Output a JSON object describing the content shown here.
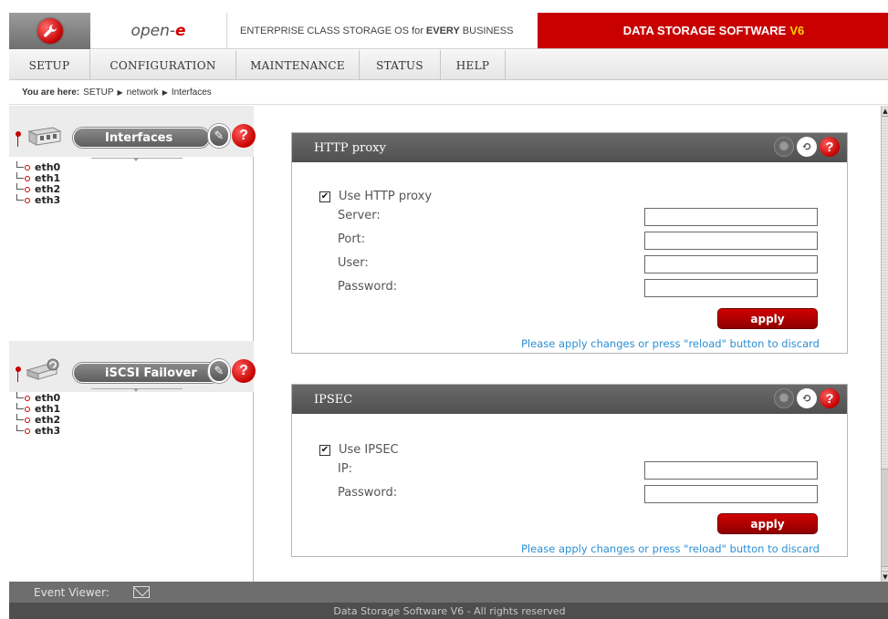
{
  "header": {
    "brand_prefix": "open-",
    "brand_suffix": "e",
    "tagline_prefix": "ENTERPRISE CLASS STORAGE OS for",
    "tagline_emphasis": "EVERY",
    "tagline_suffix": "BUSINESS",
    "product": "DATA STORAGE SOFTWARE",
    "product_version": "V6"
  },
  "menu": {
    "items": [
      {
        "label": "SETUP"
      },
      {
        "label": "CONFIGURATION"
      },
      {
        "label": "MAINTENANCE"
      },
      {
        "label": "STATUS"
      },
      {
        "label": "HELP"
      }
    ]
  },
  "breadcrumb": {
    "prefix": "You are here:",
    "path": [
      "SETUP",
      "network",
      "Interfaces"
    ]
  },
  "left_panel": {
    "interfaces": {
      "title": "Interfaces",
      "items": [
        "eth0",
        "eth1",
        "eth2",
        "eth3"
      ]
    },
    "failover": {
      "title": "iSCSI Failover",
      "items": [
        "eth0",
        "eth1",
        "eth2",
        "eth3"
      ]
    }
  },
  "http_proxy": {
    "title": "HTTP proxy",
    "checkbox_label": "Use HTTP proxy",
    "checked": true,
    "fields": [
      {
        "label": "Server:",
        "value": ""
      },
      {
        "label": "Port:",
        "value": ""
      },
      {
        "label": "User:",
        "value": ""
      },
      {
        "label": "Password:",
        "value": ""
      }
    ],
    "apply_label": "apply",
    "hint": "Please apply changes or press \"reload\" button to discard"
  },
  "ipsec": {
    "title": "IPSEC",
    "checkbox_label": "Use IPSEC",
    "checked": true,
    "fields": [
      {
        "label": "IP:",
        "value": ""
      },
      {
        "label": "Password:",
        "value": ""
      }
    ],
    "apply_label": "apply",
    "hint": "Please apply changes or press \"reload\" button to discard"
  },
  "event_viewer": {
    "label": "Event Viewer:"
  },
  "footer": {
    "text": "Data Storage Software V6 - All rights reserved"
  },
  "colors": {
    "accent_red": "#c80000",
    "header_dark": "#5a5a5a",
    "link_blue": "#2b8fd3"
  },
  "icons": {
    "logo": "wrench-logo-icon",
    "help": "help-icon",
    "tools": "wrench-icon",
    "reload": "reload-icon",
    "settings": "gear-icon",
    "mail": "mail-icon"
  }
}
